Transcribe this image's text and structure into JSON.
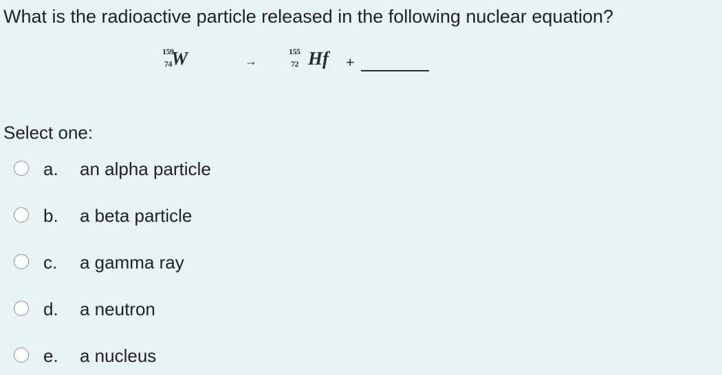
{
  "question": {
    "text": "What is the radioactive particle released in the following nuclear equation?"
  },
  "equation": {
    "reactant": {
      "mass_number": "159",
      "atomic_number": "74",
      "symbol": "W"
    },
    "arrow": "→",
    "product": {
      "mass_number": "155",
      "atomic_number": "72",
      "symbol": "Hf"
    },
    "plus": "+"
  },
  "prompt": "Select one:",
  "options": [
    {
      "letter": "a.",
      "text": "an alpha particle"
    },
    {
      "letter": "b.",
      "text": "a beta particle"
    },
    {
      "letter": "c.",
      "text": "a gamma ray"
    },
    {
      "letter": "d.",
      "text": "a neutron"
    },
    {
      "letter": "e.",
      "text": "a nucleus"
    }
  ],
  "colors": {
    "background": "#e7f3f5",
    "text": "#1d2125",
    "radio_border": "#8a8f94",
    "radio_fill": "#ffffff"
  }
}
